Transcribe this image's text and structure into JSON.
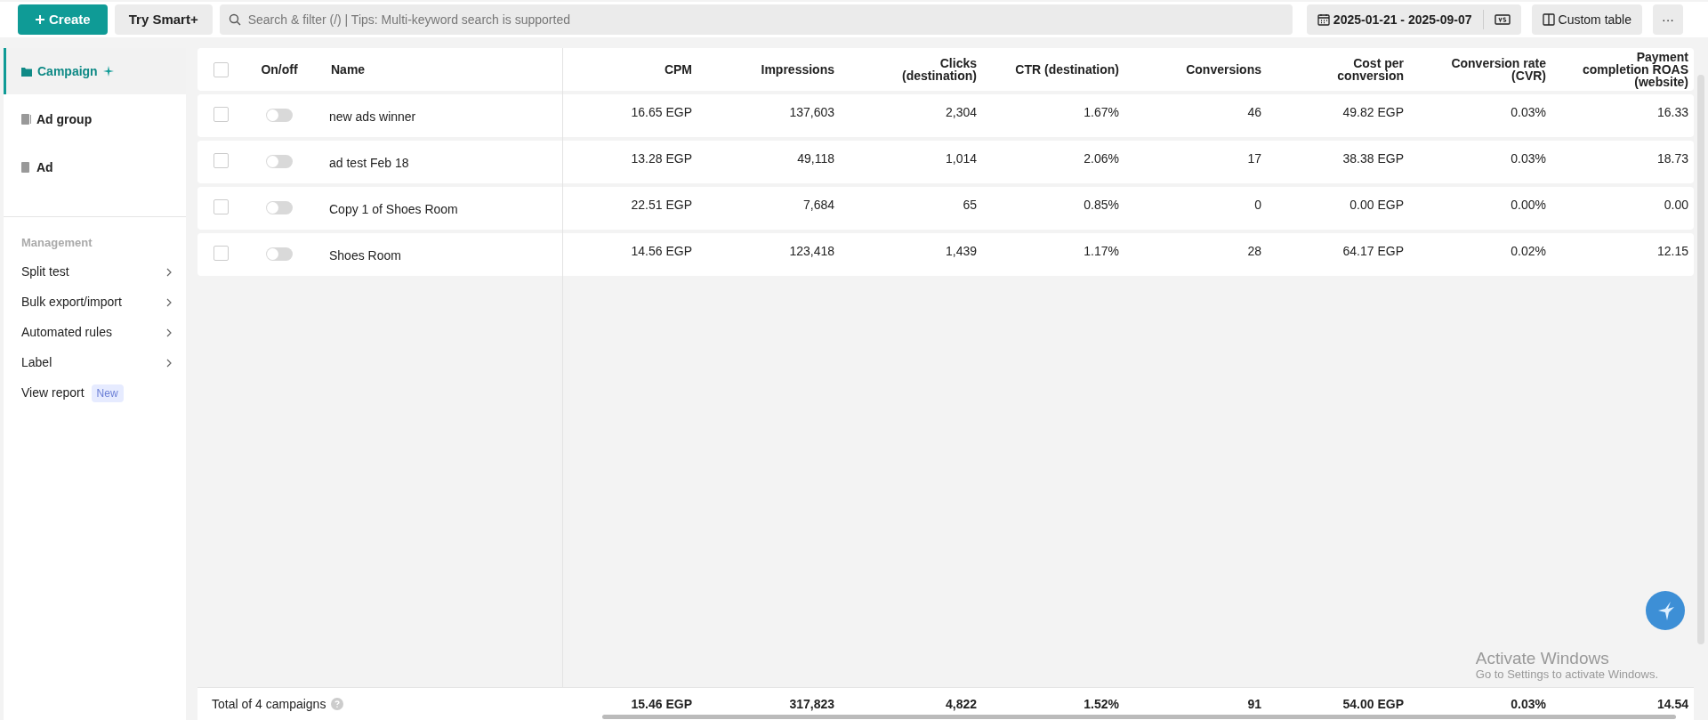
{
  "toolbar": {
    "create": "Create",
    "smart": "Try Smart+",
    "search_placeholder": "Search & filter (/) | Tips: Multi-keyword search is supported",
    "date_range": "2025-01-21 - 2025-09-07",
    "custom_table": "Custom table",
    "more": "···"
  },
  "sidebar": {
    "levels": [
      {
        "label": "Campaign",
        "selected": true
      },
      {
        "label": "Ad group",
        "selected": false
      },
      {
        "label": "Ad",
        "selected": false
      }
    ],
    "management_title": "Management",
    "items": [
      {
        "label": "Split test",
        "kind": "submenu"
      },
      {
        "label": "Bulk export/import",
        "kind": "submenu"
      },
      {
        "label": "Automated rules",
        "kind": "submenu"
      },
      {
        "label": "Label",
        "kind": "submenu"
      },
      {
        "label": "View report",
        "kind": "badge",
        "badge": "New"
      }
    ]
  },
  "table": {
    "select_all_checked": false,
    "columns": [
      "On/off",
      "Name",
      "CPM",
      "Impressions",
      "Clicks (destination)",
      "CTR (destination)",
      "Conversions",
      "Cost per conversion",
      "Conversion rate (CVR)",
      "Payment completion ROAS (website)"
    ],
    "rows": [
      {
        "checked": false,
        "on": false,
        "name": "new ads winner",
        "values": [
          "16.65 EGP",
          "137,603",
          "2,304",
          "1.67%",
          "46",
          "49.82 EGP",
          "0.03%",
          "16.33"
        ]
      },
      {
        "checked": false,
        "on": false,
        "name": "ad test Feb 18",
        "values": [
          "13.28 EGP",
          "49,118",
          "1,014",
          "2.06%",
          "17",
          "38.38 EGP",
          "0.03%",
          "18.73"
        ]
      },
      {
        "checked": false,
        "on": false,
        "name": "Copy 1 of Shoes Room",
        "values": [
          "22.51 EGP",
          "7,684",
          "65",
          "0.85%",
          "0",
          "0.00 EGP",
          "0.00%",
          "0.00"
        ]
      },
      {
        "checked": false,
        "on": false,
        "name": "Shoes Room",
        "values": [
          "14.56 EGP",
          "123,418",
          "1,439",
          "1.17%",
          "28",
          "64.17 EGP",
          "0.02%",
          "12.15"
        ]
      }
    ],
    "footer": {
      "label": "Total of 4 campaigns",
      "values": [
        "15.46 EGP",
        "317,823",
        "4,822",
        "1.52%",
        "91",
        "54.00 EGP",
        "0.03%",
        "14.54"
      ]
    }
  },
  "os_notice": {
    "title": "Activate Windows",
    "subtitle": "Go to Settings to activate Windows."
  }
}
